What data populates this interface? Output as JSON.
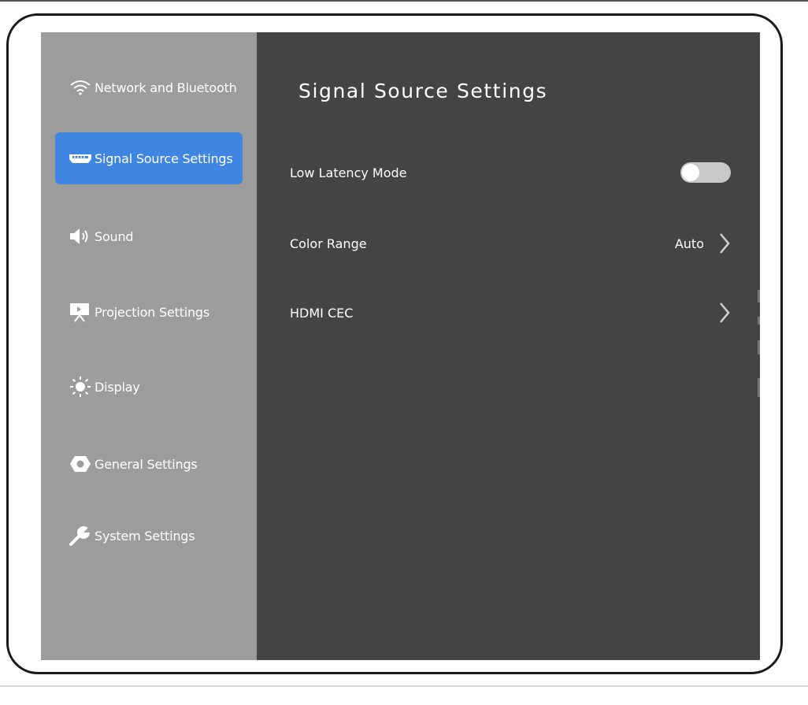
{
  "sidebar": {
    "items": [
      {
        "label": "Network and Bluetooth",
        "icon": "wifi-icon",
        "active": false
      },
      {
        "label": "Signal Source Settings",
        "icon": "hdmi-port-icon",
        "active": true
      },
      {
        "label": "Sound",
        "icon": "speaker-icon",
        "active": false
      },
      {
        "label": "Projection Settings",
        "icon": "projector-screen-icon",
        "active": false
      },
      {
        "label": "Display",
        "icon": "sun-brightness-icon",
        "active": false
      },
      {
        "label": "General Settings",
        "icon": "gear-icon",
        "active": false
      },
      {
        "label": "System Settings",
        "icon": "wrench-icon",
        "active": false
      }
    ]
  },
  "main": {
    "title": "Signal Source Settings",
    "settings": [
      {
        "label": "Low Latency Mode",
        "control": "toggle",
        "enabled": false
      },
      {
        "label": "Color Range",
        "value": "Auto",
        "control": "chevron-right-icon"
      },
      {
        "label": "HDMI CEC",
        "control": "chevron-right-icon"
      }
    ]
  },
  "colors": {
    "sidebar_bg": "#9c9c9c",
    "main_bg": "#444444",
    "active_item": "#3f85e2",
    "toggle_off": "#c9c9c9",
    "text": "#ffffff"
  }
}
